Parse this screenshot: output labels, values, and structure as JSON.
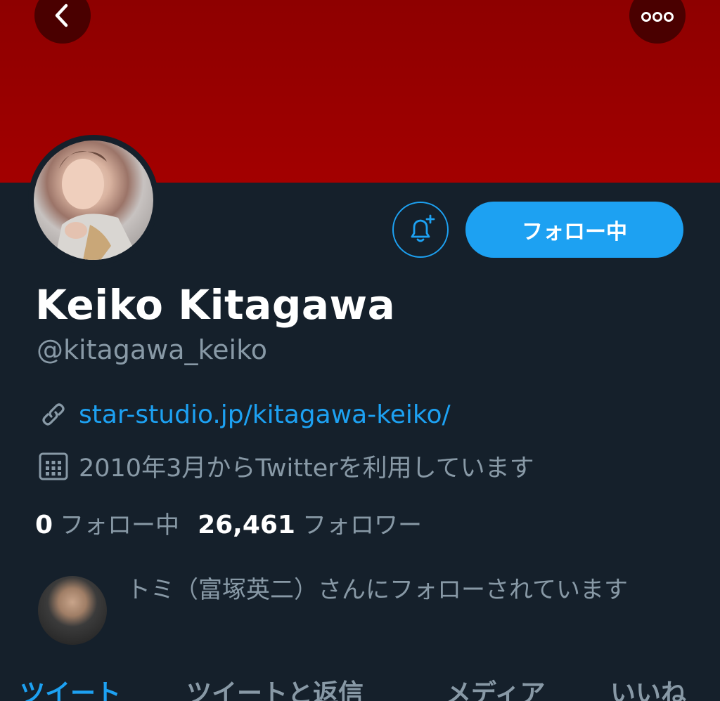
{
  "colors": {
    "accent": "#1da1f2",
    "banner": "#9a0000",
    "background": "#15202b",
    "muted": "#8899a6"
  },
  "nav": {
    "back_icon": "chevron-left-icon",
    "more_icon": "more-dots-icon"
  },
  "actions": {
    "bell_icon": "bell-plus-icon",
    "follow_label": "フォロー中"
  },
  "profile": {
    "display_name": "Keiko Kitagawa",
    "handle": "@kitagawa_keiko",
    "link_icon": "link-icon",
    "link": "star-studio.jp/kitagawa-keiko/",
    "calendar_icon": "calendar-icon",
    "joined": "2010年3月からTwitterを利用しています"
  },
  "stats": {
    "following_count": "0",
    "following_label": "フォロー中",
    "followers_count": "26,461",
    "followers_label": "フォロワー"
  },
  "followed_by": {
    "text": "トミ（富塚英二）さんにフォローされています"
  },
  "tabs": [
    {
      "label": "ツイート"
    },
    {
      "label": "ツイートと返信"
    },
    {
      "label": "メディア"
    },
    {
      "label": "いいね"
    }
  ]
}
